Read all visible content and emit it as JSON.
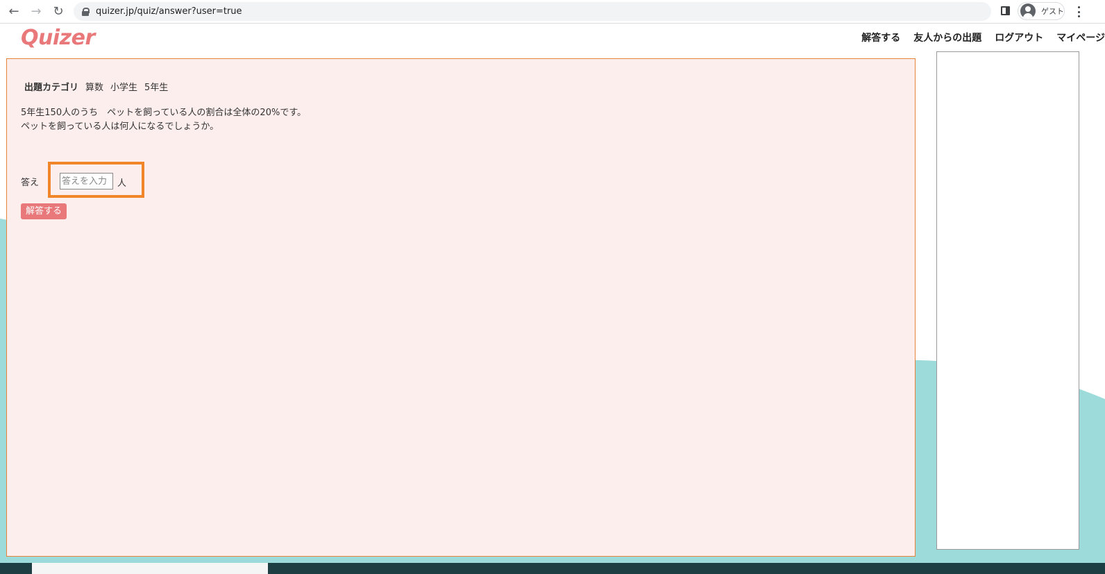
{
  "browser": {
    "url": "quizer.jp/quiz/answer?user=true",
    "profile_label": "ゲスト"
  },
  "header": {
    "logo": "Quizer",
    "nav": [
      "解答する",
      "友人からの出題",
      "ログアウト",
      "マイページ"
    ]
  },
  "quiz": {
    "category_label": "出題カテゴリ",
    "category_tags": [
      "算数",
      "小学生",
      "5年生"
    ],
    "question_lines": [
      "5年生150人のうち　ペットを飼っている人の割合は全体の20%です。",
      "ペットを飼っている人は何人になるでしょうか。"
    ],
    "answer_label": "答え",
    "answer_placeholder": "答えを入力",
    "answer_value": "",
    "unit": "人",
    "submit_label": "解答する"
  },
  "colors": {
    "brand": "#e8787a",
    "card_bg": "#fdeeee",
    "card_border": "#e8833a",
    "highlight": "#f0852a",
    "wave": "#9cdbd9"
  }
}
